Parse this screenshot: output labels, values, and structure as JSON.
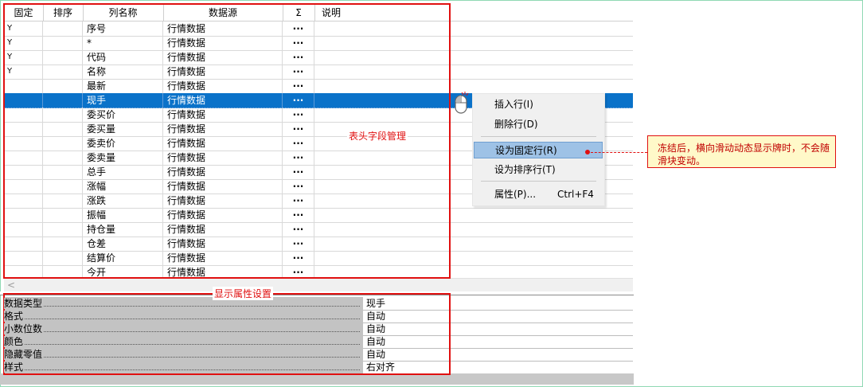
{
  "grid": {
    "headers": {
      "fixed": "固定",
      "sort": "排序",
      "name": "列名称",
      "source": "数据源",
      "sum": "Σ",
      "desc": "说明"
    },
    "rows": [
      {
        "fixed": "Y",
        "name": "序号",
        "source": "行情数据",
        "sum": "···"
      },
      {
        "fixed": "Y",
        "name": "*",
        "source": "行情数据",
        "sum": "···"
      },
      {
        "fixed": "Y",
        "name": "代码",
        "source": "行情数据",
        "sum": "···"
      },
      {
        "fixed": "Y",
        "name": "名称",
        "source": "行情数据",
        "sum": "···"
      },
      {
        "fixed": "",
        "name": "最新",
        "source": "行情数据",
        "sum": "···"
      },
      {
        "fixed": "",
        "name": "现手",
        "source": "行情数据",
        "sum": "···"
      },
      {
        "fixed": "",
        "name": "委买价",
        "source": "行情数据",
        "sum": "···"
      },
      {
        "fixed": "",
        "name": "委买量",
        "source": "行情数据",
        "sum": "···"
      },
      {
        "fixed": "",
        "name": "委卖价",
        "source": "行情数据",
        "sum": "···"
      },
      {
        "fixed": "",
        "name": "委卖量",
        "source": "行情数据",
        "sum": "···"
      },
      {
        "fixed": "",
        "name": "总手",
        "source": "行情数据",
        "sum": "···"
      },
      {
        "fixed": "",
        "name": "涨幅",
        "source": "行情数据",
        "sum": "···"
      },
      {
        "fixed": "",
        "name": "涨跌",
        "source": "行情数据",
        "sum": "···"
      },
      {
        "fixed": "",
        "name": "振幅",
        "source": "行情数据",
        "sum": "···"
      },
      {
        "fixed": "",
        "name": "持仓量",
        "source": "行情数据",
        "sum": "···"
      },
      {
        "fixed": "",
        "name": "仓差",
        "source": "行情数据",
        "sum": "···"
      },
      {
        "fixed": "",
        "name": "结算价",
        "source": "行情数据",
        "sum": "···"
      },
      {
        "fixed": "",
        "name": "今开",
        "source": "行情数据",
        "sum": "···"
      }
    ],
    "selected_row": 5,
    "annotation_label": "表头字段管理"
  },
  "scrollbar": {
    "left_arrow": "<"
  },
  "properties": {
    "annotation_label": "显示属性设置",
    "rows": [
      {
        "key": "数据类型",
        "value": "现手"
      },
      {
        "key": "格式",
        "value": "自动"
      },
      {
        "key": "小数位数",
        "value": "自动"
      },
      {
        "key": "颜色",
        "value": "自动"
      },
      {
        "key": "隐藏零值",
        "value": "自动"
      },
      {
        "key": "样式",
        "value": "右对齐"
      }
    ]
  },
  "context_menu": {
    "items": [
      {
        "label": "插入行(I)",
        "shortcut": ""
      },
      {
        "label": "删除行(D)",
        "shortcut": ""
      },
      {
        "label": "设为固定行(R)",
        "shortcut": "",
        "highlighted": true
      },
      {
        "label": "设为排序行(T)",
        "shortcut": ""
      },
      {
        "label": "属性(P)...",
        "shortcut": "Ctrl+F4"
      }
    ]
  },
  "callout": {
    "text": "冻结后，横向滑动动态显示牌时，不会随滑块变动。"
  },
  "colors": {
    "accent_red": "#e01010",
    "selection_blue": "#0a72c9",
    "menu_highlight": "#9ec2e6",
    "callout_bg": "#fff9c9"
  }
}
